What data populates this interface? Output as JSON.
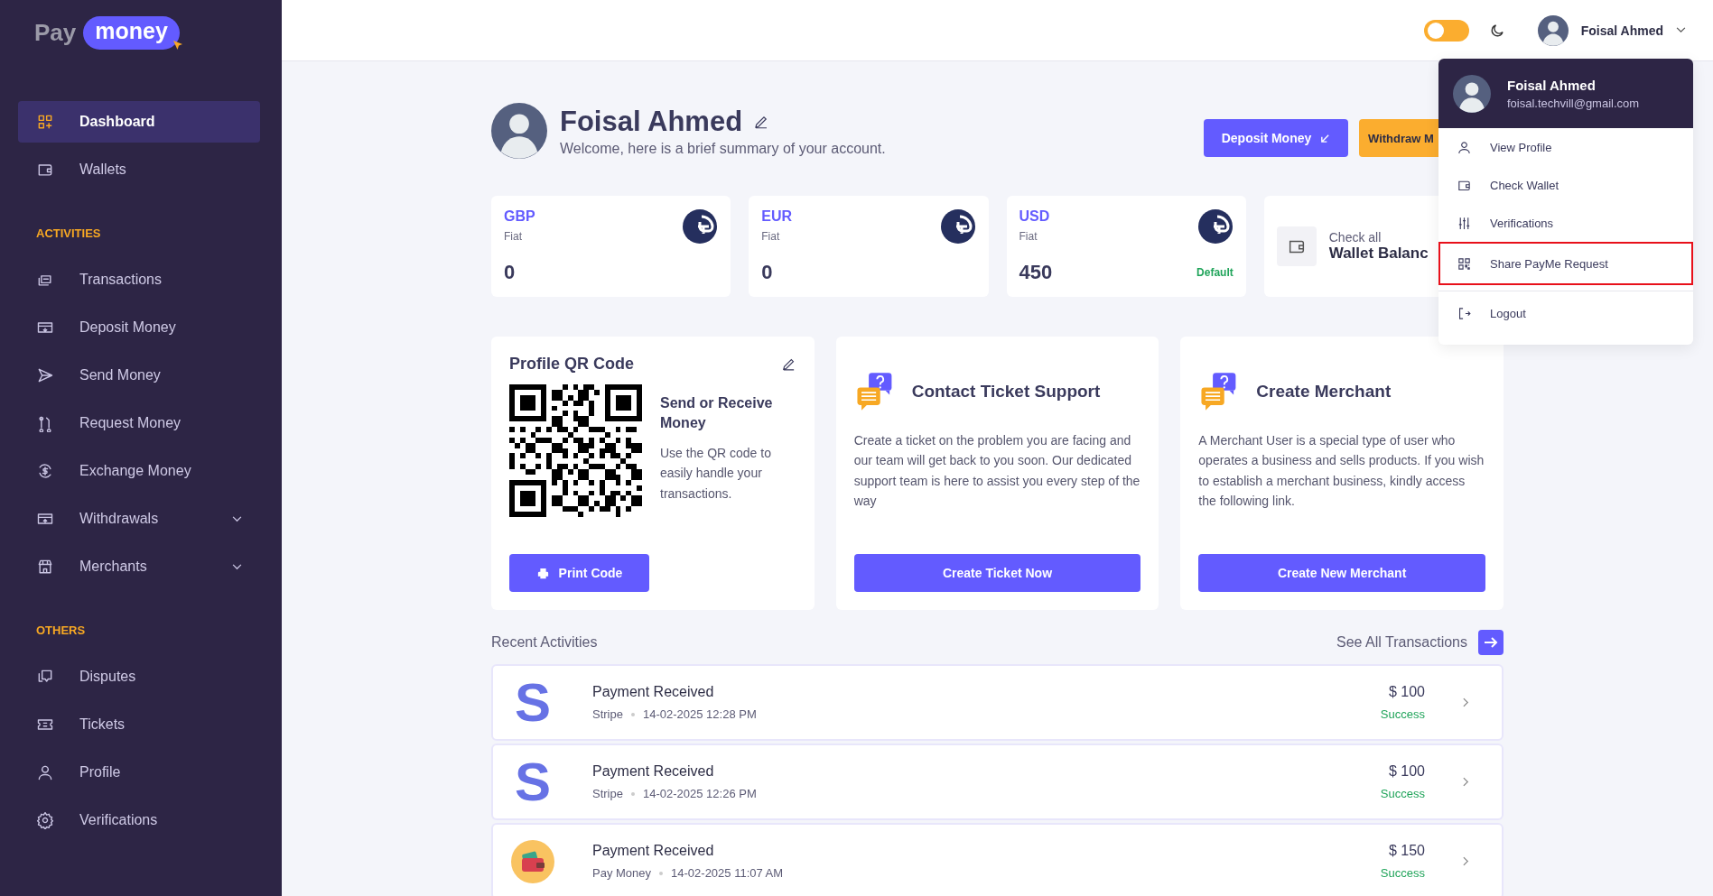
{
  "logo": {
    "text": "Pay",
    "badge": "money"
  },
  "sidebar": {
    "groups": [
      {
        "items": [
          {
            "label": "Dashboard",
            "selected": true,
            "has_submenu": false
          },
          {
            "label": "Wallets",
            "selected": false,
            "has_submenu": false
          }
        ]
      },
      {
        "heading": "ACTIVITIES",
        "items": [
          {
            "label": "Transactions",
            "selected": false,
            "has_submenu": false
          },
          {
            "label": "Deposit Money",
            "selected": false,
            "has_submenu": false
          },
          {
            "label": "Send Money",
            "selected": false,
            "has_submenu": false
          },
          {
            "label": "Request Money",
            "selected": false,
            "has_submenu": false
          },
          {
            "label": "Exchange Money",
            "selected": false,
            "has_submenu": false
          },
          {
            "label": "Withdrawals",
            "selected": false,
            "has_submenu": true
          },
          {
            "label": "Merchants",
            "selected": false,
            "has_submenu": true
          }
        ]
      },
      {
        "heading": "OTHERS",
        "items": [
          {
            "label": "Disputes",
            "selected": false,
            "has_submenu": false
          },
          {
            "label": "Tickets",
            "selected": false,
            "has_submenu": false
          },
          {
            "label": "Profile",
            "selected": false,
            "has_submenu": false
          },
          {
            "label": "Verifications",
            "selected": false,
            "has_submenu": false
          }
        ]
      }
    ]
  },
  "header": {
    "dark_mode": false,
    "user_name": "Foisal Ahmed"
  },
  "profile": {
    "name": "Foisal Ahmed",
    "subtitle": "Welcome, here is a brief summary of your account.",
    "actions": [
      {
        "label": "Deposit Money",
        "kind": "primary"
      },
      {
        "label": "Withdraw M",
        "kind": "secondary"
      }
    ]
  },
  "wallets": [
    {
      "currency": "GBP",
      "type": "Fiat",
      "balance": "0"
    },
    {
      "currency": "EUR",
      "type": "Fiat",
      "balance": "0"
    },
    {
      "currency": "USD",
      "type": "Fiat",
      "balance": "450",
      "badge": "Default"
    }
  ],
  "balance_link": {
    "caption": "Check all",
    "title": "Wallet Balanc"
  },
  "qr_card": {
    "title": "Profile QR Code",
    "heading": "Send or Receive Money",
    "text": "Use the QR code to easily handle your transactions.",
    "button": "Print Code"
  },
  "info_cards": [
    {
      "title": "Contact Ticket Support",
      "text": "Create a ticket on the problem you are facing and our team will get back to you soon. Our dedicated support team is here to assist you every step of the way",
      "button": "Create Ticket Now"
    },
    {
      "title": "Create Merchant",
      "text": "A Merchant User is a special type of user who operates a business and sells products. If you wish to establish a merchant business, kindly access the following link.",
      "button": "Create New Merchant"
    }
  ],
  "recent": {
    "title": "Recent Activities",
    "link": "See All Transactions",
    "rows": [
      {
        "logo": {
          "kind": "letter",
          "text": "S"
        },
        "title": "Payment Received",
        "method": "Stripe",
        "datetime": "14-02-2025 12:28 PM",
        "amount": "$ 100",
        "status": "Success"
      },
      {
        "logo": {
          "kind": "letter",
          "text": "S"
        },
        "title": "Payment Received",
        "method": "Stripe",
        "datetime": "14-02-2025 12:26 PM",
        "amount": "$ 100",
        "status": "Success"
      },
      {
        "logo": {
          "kind": "wallet"
        },
        "title": "Payment Received",
        "method": "Pay Money",
        "datetime": "14-02-2025 11:07 AM",
        "amount": "$ 150",
        "status": "Success"
      }
    ]
  },
  "user_menu": {
    "name": "Foisal Ahmed",
    "email": "foisal.techvill@gmail.com",
    "items": [
      {
        "label": "View Profile",
        "highlighted": false
      },
      {
        "label": "Check Wallet",
        "highlighted": false
      },
      {
        "label": "Verifications",
        "highlighted": false
      },
      {
        "label": "Share PayMe Request",
        "highlighted": true
      },
      {
        "label": "Logout",
        "highlighted": false
      }
    ]
  }
}
